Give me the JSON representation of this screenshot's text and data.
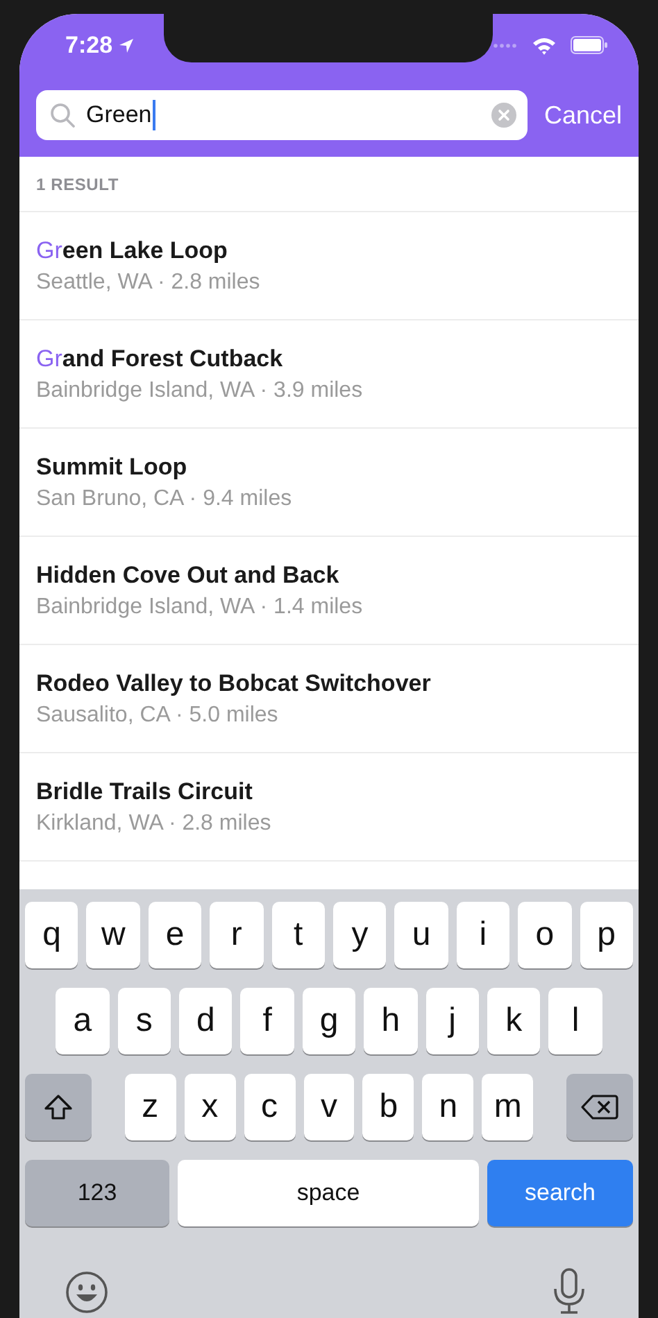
{
  "status_bar": {
    "time": "7:28"
  },
  "search": {
    "value": "Green",
    "clear": true,
    "cancel": "Cancel"
  },
  "results_header": "1 RESULT",
  "results": [
    {
      "title_parts": [
        {
          "text": "Gr",
          "highlighted": true
        },
        {
          "text": "een Lake Loop",
          "highlighted": false
        }
      ],
      "subtitle": "Seattle, WA · 2.8 miles"
    },
    {
      "title_parts": [
        {
          "text": "Gr",
          "highlighted": true
        },
        {
          "text": "and Forest Cutback",
          "highlighted": false
        }
      ],
      "subtitle": "Bainbridge Island, WA · 3.9 miles"
    },
    {
      "title_parts": [
        {
          "text": "Summit Loop",
          "highlighted": false
        }
      ],
      "subtitle": "San Bruno, CA · 9.4 miles"
    },
    {
      "title_parts": [
        {
          "text": "Hidden Cove Out and Back",
          "highlighted": false
        }
      ],
      "subtitle": "Bainbridge Island, WA · 1.4 miles"
    },
    {
      "title_parts": [
        {
          "text": "Rodeo Valley to Bobcat Switchover",
          "highlighted": false
        }
      ],
      "subtitle": "Sausalito, CA · 5.0 miles"
    },
    {
      "title_parts": [
        {
          "text": "Bridle Trails Circuit",
          "highlighted": false
        }
      ],
      "subtitle": "Kirkland, WA · 2.8 miles"
    }
  ],
  "keyboard": {
    "rows": [
      {
        "keys": [
          {
            "kind": "letter",
            "label": "q"
          },
          {
            "kind": "letter",
            "label": "w"
          },
          {
            "kind": "letter",
            "label": "e"
          },
          {
            "kind": "letter",
            "label": "r"
          },
          {
            "kind": "letter",
            "label": "t"
          },
          {
            "kind": "letter",
            "label": "y"
          },
          {
            "kind": "letter",
            "label": "u"
          },
          {
            "kind": "letter",
            "label": "i"
          },
          {
            "kind": "letter",
            "label": "o"
          },
          {
            "kind": "letter",
            "label": "p"
          }
        ]
      },
      {
        "keys": [
          {
            "kind": "letter",
            "label": "a"
          },
          {
            "kind": "letter",
            "label": "s"
          },
          {
            "kind": "letter",
            "label": "d"
          },
          {
            "kind": "letter",
            "label": "f"
          },
          {
            "kind": "letter",
            "label": "g"
          },
          {
            "kind": "letter",
            "label": "h"
          },
          {
            "kind": "letter",
            "label": "j"
          },
          {
            "kind": "letter",
            "label": "k"
          },
          {
            "kind": "letter",
            "label": "l"
          }
        ]
      },
      {
        "keys": [
          {
            "kind": "shift"
          },
          {
            "kind": "letter",
            "label": "z"
          },
          {
            "kind": "letter",
            "label": "x"
          },
          {
            "kind": "letter",
            "label": "c"
          },
          {
            "kind": "letter",
            "label": "v"
          },
          {
            "kind": "letter",
            "label": "b"
          },
          {
            "kind": "letter",
            "label": "n"
          },
          {
            "kind": "letter",
            "label": "m"
          },
          {
            "kind": "backspace"
          }
        ]
      },
      {
        "keys": [
          {
            "kind": "numbers",
            "label": "123"
          },
          {
            "kind": "space",
            "label": "space"
          },
          {
            "kind": "action",
            "label": "search"
          }
        ]
      }
    ]
  }
}
